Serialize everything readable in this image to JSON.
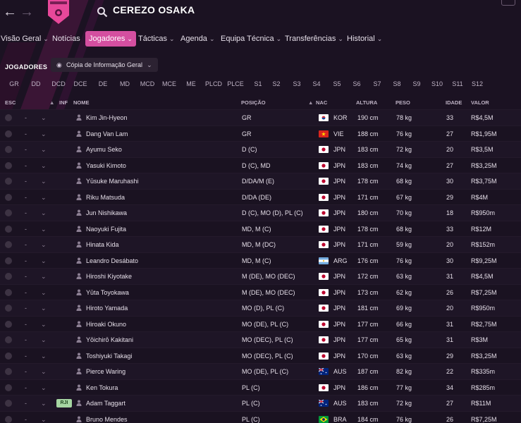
{
  "club_name": "CEREZO OSAKA",
  "menu": [
    "Visão Geral",
    "Notícias",
    "Jogadores",
    "Tácticas",
    "Agenda",
    "Equipa Técnica",
    "Transferências",
    "Historial"
  ],
  "menu_active": 2,
  "section_title": "JOGADORES",
  "view_button": "Cópia de Informação Geral",
  "filters": [
    "GR",
    "DD",
    "DCD",
    "DCE",
    "DE",
    "MD",
    "MCD",
    "MCE",
    "ME",
    "PLCD",
    "PLCE",
    "S1",
    "S2",
    "S3",
    "S4",
    "S5",
    "S6",
    "S7",
    "S8",
    "S9",
    "S10",
    "S11",
    "S12"
  ],
  "columns": {
    "esc": "ESC",
    "inf": "INF",
    "nome": "NOME",
    "posicao": "POSIÇÃO",
    "nac": "NAC",
    "altura": "ALTURA",
    "peso": "PESO",
    "idade": "IDADE",
    "valor": "VALOR"
  },
  "players": [
    {
      "name": "Kim Jin-Hyeon",
      "pos": "GR",
      "nat": "KOR",
      "height": "190 cm",
      "weight": "78 kg",
      "age": "33",
      "value": "R$4,5M",
      "inf": ""
    },
    {
      "name": "Dang Van Lam",
      "pos": "GR",
      "nat": "VIE",
      "height": "188 cm",
      "weight": "76 kg",
      "age": "27",
      "value": "R$1,95M",
      "inf": ""
    },
    {
      "name": "Ayumu Seko",
      "pos": "D (C)",
      "nat": "JPN",
      "height": "183 cm",
      "weight": "72 kg",
      "age": "20",
      "value": "R$3,5M",
      "inf": ""
    },
    {
      "name": "Yasuki Kimoto",
      "pos": "D (C), MD",
      "nat": "JPN",
      "height": "183 cm",
      "weight": "74 kg",
      "age": "27",
      "value": "R$3,25M",
      "inf": ""
    },
    {
      "name": "Yūsuke Maruhashi",
      "pos": "D/DA/M (E)",
      "nat": "JPN",
      "height": "178 cm",
      "weight": "68 kg",
      "age": "30",
      "value": "R$3,75M",
      "inf": ""
    },
    {
      "name": "Riku Matsuda",
      "pos": "D/DA (DE)",
      "nat": "JPN",
      "height": "171 cm",
      "weight": "67 kg",
      "age": "29",
      "value": "R$4M",
      "inf": ""
    },
    {
      "name": "Jun Nishikawa",
      "pos": "D (C), MO (D), PL (C)",
      "nat": "JPN",
      "height": "180 cm",
      "weight": "70 kg",
      "age": "18",
      "value": "R$950m",
      "inf": ""
    },
    {
      "name": "Naoyuki Fujita",
      "pos": "MD, M (C)",
      "nat": "JPN",
      "height": "178 cm",
      "weight": "68 kg",
      "age": "33",
      "value": "R$12M",
      "inf": ""
    },
    {
      "name": "Hinata Kida",
      "pos": "MD, M (DC)",
      "nat": "JPN",
      "height": "171 cm",
      "weight": "59 kg",
      "age": "20",
      "value": "R$152m",
      "inf": ""
    },
    {
      "name": "Leandro Desábato",
      "pos": "MD, M (C)",
      "nat": "ARG",
      "height": "176 cm",
      "weight": "76 kg",
      "age": "30",
      "value": "R$9,25M",
      "inf": ""
    },
    {
      "name": "Hiroshi Kiyotake",
      "pos": "M (DE), MO (DEC)",
      "nat": "JPN",
      "height": "172 cm",
      "weight": "63 kg",
      "age": "31",
      "value": "R$4,5M",
      "inf": ""
    },
    {
      "name": "Yūta Toyokawa",
      "pos": "M (DE), MO (DEC)",
      "nat": "JPN",
      "height": "173 cm",
      "weight": "62 kg",
      "age": "26",
      "value": "R$7,25M",
      "inf": ""
    },
    {
      "name": "Hiroto Yamada",
      "pos": "MO (D), PL (C)",
      "nat": "JPN",
      "height": "181 cm",
      "weight": "69 kg",
      "age": "20",
      "value": "R$950m",
      "inf": ""
    },
    {
      "name": "Hiroaki Okuno",
      "pos": "MO (DE), PL (C)",
      "nat": "JPN",
      "height": "177 cm",
      "weight": "66 kg",
      "age": "31",
      "value": "R$2,75M",
      "inf": ""
    },
    {
      "name": "Yōichirō Kakitani",
      "pos": "MO (DEC), PL (C)",
      "nat": "JPN",
      "height": "177 cm",
      "weight": "65 kg",
      "age": "31",
      "value": "R$3M",
      "inf": ""
    },
    {
      "name": "Toshiyuki Takagi",
      "pos": "MO (DEC), PL (C)",
      "nat": "JPN",
      "height": "170 cm",
      "weight": "63 kg",
      "age": "29",
      "value": "R$3,25M",
      "inf": ""
    },
    {
      "name": "Pierce Waring",
      "pos": "MO (DE), PL (C)",
      "nat": "AUS",
      "height": "187 cm",
      "weight": "82 kg",
      "age": "22",
      "value": "R$335m",
      "inf": ""
    },
    {
      "name": "Ken Tokura",
      "pos": "PL (C)",
      "nat": "JPN",
      "height": "186 cm",
      "weight": "77 kg",
      "age": "34",
      "value": "R$285m",
      "inf": ""
    },
    {
      "name": "Adam Taggart",
      "pos": "PL (C)",
      "nat": "AUS",
      "height": "183 cm",
      "weight": "72 kg",
      "age": "27",
      "value": "R$11M",
      "inf": "RJI"
    },
    {
      "name": "Bruno Mendes",
      "pos": "PL (C)",
      "nat": "BRA",
      "height": "184 cm",
      "weight": "76 kg",
      "age": "26",
      "value": "R$7,25M",
      "inf": ""
    }
  ],
  "dash": "-",
  "accent_color": "#d44fa0"
}
